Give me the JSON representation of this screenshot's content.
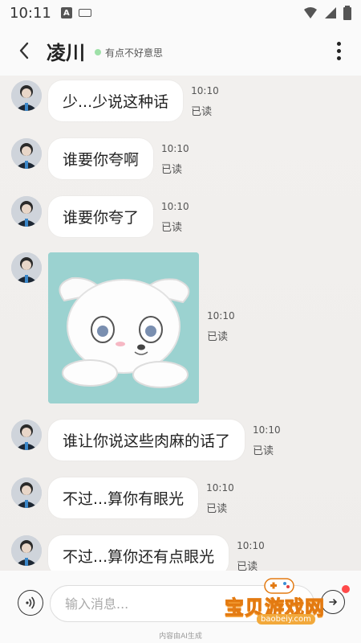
{
  "status_bar": {
    "time": "10:11"
  },
  "header": {
    "contact_name": "凌川",
    "status_text": "有点不好意思"
  },
  "messages": [
    {
      "text": "少...少说这种话",
      "time": "10:10",
      "read": "已读"
    },
    {
      "text": "谁要你夸啊",
      "time": "10:10",
      "read": "已读"
    },
    {
      "text": "谁要你夸了",
      "time": "10:10",
      "read": "已读"
    },
    {
      "type": "sticker",
      "icon": "puppy-sticker",
      "time": "10:10",
      "read": "已读"
    },
    {
      "text": "谁让你说这些肉麻的话了",
      "time": "10:10",
      "read": "已读"
    },
    {
      "text": "不过...算你有眼光",
      "time": "10:10",
      "read": "已读"
    },
    {
      "text": "不过...算你还有点眼光",
      "time": "10:10",
      "read": "已读"
    }
  ],
  "input": {
    "placeholder": "输入消息...",
    "value": ""
  },
  "footer": {
    "ai_note": "内容由AI生成"
  },
  "watermark": {
    "title": "宝贝游戏网",
    "url": "baobeiy.com"
  },
  "colors": {
    "bubble": "#ffffff",
    "chat_bg": "#f0eeec",
    "status_dot": "#9ee0a8",
    "sticker_bg": "#9bd2d0"
  }
}
